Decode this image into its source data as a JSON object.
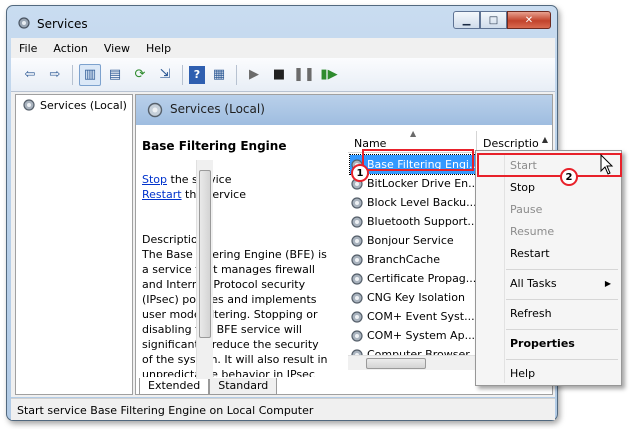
{
  "window": {
    "title": "Services",
    "min_icon": "minimize-icon",
    "max_icon": "maximize-icon",
    "close_icon": "close-icon"
  },
  "menu": [
    "File",
    "Action",
    "View",
    "Help"
  ],
  "tree": {
    "root_label": "Services (Local)"
  },
  "pane": {
    "header": "Services (Local)"
  },
  "detail": {
    "service_name": "Base Filtering Engine",
    "stop_link": "Stop",
    "stop_rest": " the service",
    "restart_link": "Restart",
    "restart_rest": " the service",
    "description_label": "Description:",
    "description": "The Base Filtering Engine (BFE) is a service that manages firewall and Internet Protocol security (IPsec) policies and implements user mode filtering. Stopping or disabling the BFE service will significantly reduce the security of the system. It will also result in unpredictable behavior in IPsec"
  },
  "columns": {
    "name": "Name",
    "description": "Descriptio"
  },
  "services": [
    "Base Filtering Engi...",
    "BitLocker Drive En...",
    "Block Level Backu...",
    "Bluetooth Support...",
    "Bonjour Service",
    "BranchCache",
    "Certificate Propag...",
    "CNG Key Isolation",
    "COM+ Event Syst...",
    "COM+ System Ap...",
    "Computer Browser"
  ],
  "tabs": {
    "extended": "Extended",
    "standard": "Standard"
  },
  "status": "Start service Base Filtering Engine on Local Computer",
  "context_menu": {
    "start": "Start",
    "stop": "Stop",
    "pause": "Pause",
    "resume": "Resume",
    "restart": "Restart",
    "all_tasks": "All Tasks",
    "refresh": "Refresh",
    "properties": "Properties",
    "help": "Help"
  },
  "annotations": {
    "step1": "1",
    "step2": "2"
  },
  "colors": {
    "highlight": "#e8212a",
    "selection": "#3399ff",
    "link": "#0033cc"
  }
}
